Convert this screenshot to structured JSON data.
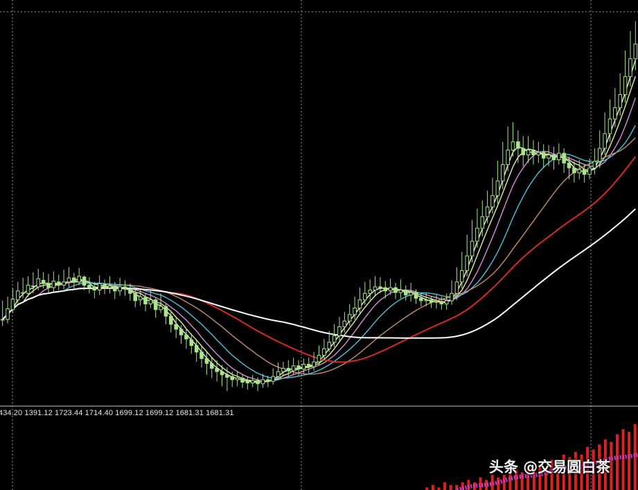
{
  "chart_data": {
    "type": "candlestick",
    "title": "",
    "main_panel": {
      "bull_color": "#a8e58b",
      "bear_color": "#a8e58b",
      "background": "#000000",
      "grid": "vertical-dotted",
      "candles": [
        [
          1680,
          1680,
          1703,
          1672
        ],
        [
          1680,
          1693,
          1708,
          1675
        ],
        [
          1692,
          1705,
          1718,
          1688
        ],
        [
          1704,
          1715,
          1726,
          1700
        ],
        [
          1712,
          1713,
          1731,
          1706
        ],
        [
          1712,
          1722,
          1733,
          1708
        ],
        [
          1721,
          1720,
          1738,
          1712
        ],
        [
          1720,
          1730,
          1742,
          1716
        ],
        [
          1728,
          1724,
          1738,
          1718
        ],
        [
          1724,
          1719,
          1736,
          1713
        ],
        [
          1719,
          1727,
          1739,
          1714
        ],
        [
          1726,
          1722,
          1735,
          1716
        ],
        [
          1722,
          1726,
          1741,
          1717
        ],
        [
          1726,
          1731,
          1744,
          1720
        ],
        [
          1731,
          1726,
          1737,
          1716
        ],
        [
          1726,
          1733,
          1743,
          1722
        ],
        [
          1732,
          1722,
          1734,
          1716
        ],
        [
          1722,
          1719,
          1732,
          1712
        ],
        [
          1720,
          1716,
          1726,
          1706
        ],
        [
          1716,
          1724,
          1734,
          1710
        ],
        [
          1723,
          1719,
          1729,
          1711
        ],
        [
          1719,
          1721,
          1733,
          1712
        ],
        [
          1721,
          1715,
          1726,
          1705
        ],
        [
          1715,
          1720,
          1731,
          1709
        ],
        [
          1720,
          1717,
          1728,
          1709
        ],
        [
          1717,
          1712,
          1724,
          1703
        ],
        [
          1712,
          1703,
          1717,
          1695
        ],
        [
          1704,
          1708,
          1716,
          1697
        ],
        [
          1707,
          1699,
          1712,
          1690
        ],
        [
          1699,
          1704,
          1717,
          1694
        ],
        [
          1704,
          1692,
          1706,
          1682
        ],
        [
          1692,
          1696,
          1712,
          1688
        ],
        [
          1696,
          1684,
          1699,
          1674
        ],
        [
          1684,
          1674,
          1690,
          1664
        ],
        [
          1674,
          1668,
          1682,
          1657
        ],
        [
          1668,
          1661,
          1673,
          1650
        ],
        [
          1661,
          1656,
          1669,
          1644
        ],
        [
          1655,
          1648,
          1663,
          1638
        ],
        [
          1648,
          1640,
          1654,
          1628
        ],
        [
          1640,
          1632,
          1647,
          1621
        ],
        [
          1632,
          1626,
          1640,
          1612
        ],
        [
          1626,
          1620,
          1634,
          1608
        ],
        [
          1620,
          1616,
          1630,
          1604
        ],
        [
          1616,
          1612,
          1624,
          1598
        ],
        [
          1612,
          1609,
          1621,
          1592
        ],
        [
          1610,
          1606,
          1616,
          1597
        ],
        [
          1606,
          1608,
          1616,
          1598
        ],
        [
          1608,
          1603,
          1612,
          1596
        ],
        [
          1604,
          1602,
          1610,
          1594
        ],
        [
          1602,
          1605,
          1612,
          1597
        ],
        [
          1605,
          1601,
          1609,
          1592
        ],
        [
          1601,
          1606,
          1613,
          1596
        ],
        [
          1606,
          1604,
          1611,
          1597
        ],
        [
          1604,
          1610,
          1620,
          1600
        ],
        [
          1610,
          1616,
          1627,
          1606
        ],
        [
          1616,
          1620,
          1628,
          1610
        ],
        [
          1620,
          1617,
          1630,
          1609
        ],
        [
          1617,
          1623,
          1633,
          1612
        ],
        [
          1623,
          1619,
          1630,
          1611
        ],
        [
          1619,
          1625,
          1632,
          1614
        ],
        [
          1625,
          1622,
          1633,
          1613
        ],
        [
          1622,
          1628,
          1640,
          1617
        ],
        [
          1628,
          1636,
          1648,
          1624
        ],
        [
          1636,
          1644,
          1656,
          1630
        ],
        [
          1644,
          1652,
          1666,
          1640
        ],
        [
          1652,
          1660,
          1674,
          1646
        ],
        [
          1660,
          1671,
          1683,
          1654
        ],
        [
          1671,
          1678,
          1689,
          1664
        ],
        [
          1678,
          1686,
          1699,
          1672
        ],
        [
          1686,
          1694,
          1708,
          1680
        ],
        [
          1694,
          1704,
          1719,
          1688
        ],
        [
          1704,
          1712,
          1726,
          1698
        ],
        [
          1712,
          1716,
          1729,
          1704
        ],
        [
          1716,
          1720,
          1733,
          1708
        ],
        [
          1720,
          1719,
          1732,
          1712
        ],
        [
          1719,
          1715,
          1727,
          1706
        ],
        [
          1715,
          1719,
          1730,
          1710
        ],
        [
          1719,
          1713,
          1725,
          1705
        ],
        [
          1713,
          1716,
          1729,
          1706
        ],
        [
          1716,
          1710,
          1722,
          1703
        ],
        [
          1710,
          1713,
          1725,
          1702
        ],
        [
          1713,
          1706,
          1717,
          1699
        ],
        [
          1706,
          1703,
          1712,
          1696
        ],
        [
          1703,
          1704,
          1712,
          1696
        ],
        [
          1704,
          1701,
          1709,
          1694
        ],
        [
          1701,
          1702,
          1710,
          1693
        ],
        [
          1702,
          1699,
          1708,
          1692
        ],
        [
          1699,
          1703,
          1712,
          1692
        ],
        [
          1703,
          1712,
          1728,
          1698
        ],
        [
          1712,
          1726,
          1744,
          1704
        ],
        [
          1726,
          1740,
          1763,
          1718
        ],
        [
          1740,
          1758,
          1784,
          1733
        ],
        [
          1758,
          1776,
          1802,
          1750
        ],
        [
          1776,
          1792,
          1816,
          1768
        ],
        [
          1792,
          1806,
          1826,
          1782
        ],
        [
          1806,
          1818,
          1838,
          1798
        ],
        [
          1818,
          1832,
          1854,
          1810
        ],
        [
          1832,
          1850,
          1875,
          1822
        ],
        [
          1850,
          1870,
          1898,
          1840
        ],
        [
          1870,
          1888,
          1917,
          1862
        ],
        [
          1888,
          1898,
          1922,
          1880
        ],
        [
          1898,
          1890,
          1912,
          1872
        ],
        [
          1890,
          1882,
          1905,
          1868
        ],
        [
          1882,
          1888,
          1905,
          1872
        ],
        [
          1888,
          1882,
          1900,
          1870
        ],
        [
          1882,
          1885,
          1898,
          1872
        ],
        [
          1885,
          1878,
          1895,
          1866
        ],
        [
          1878,
          1882,
          1894,
          1868
        ],
        [
          1882,
          1876,
          1892,
          1864
        ],
        [
          1876,
          1884,
          1896,
          1870
        ],
        [
          1884,
          1872,
          1890,
          1860
        ],
        [
          1872,
          1866,
          1880,
          1852
        ],
        [
          1866,
          1860,
          1874,
          1848
        ],
        [
          1860,
          1864,
          1876,
          1852
        ],
        [
          1864,
          1858,
          1870,
          1848
        ],
        [
          1858,
          1866,
          1878,
          1852
        ],
        [
          1866,
          1874,
          1890,
          1858
        ],
        [
          1874,
          1890,
          1912,
          1866
        ],
        [
          1890,
          1908,
          1934,
          1882
        ],
        [
          1908,
          1926,
          1950,
          1898
        ],
        [
          1926,
          1940,
          1964,
          1916
        ],
        [
          1940,
          1956,
          1982,
          1930
        ],
        [
          1956,
          1978,
          2010,
          1946
        ],
        [
          1978,
          2000,
          2034,
          1966
        ],
        [
          2000,
          2018,
          2046,
          1986
        ]
      ],
      "moving_averages": [
        {
          "period_label": "",
          "color": "#f4f1e4"
        },
        {
          "period_label": "",
          "color": "#e8f09a"
        },
        {
          "period_label": "",
          "color": "#d48fd8"
        },
        {
          "period_label": "",
          "color": "#4fc3d6"
        },
        {
          "period_label": "",
          "color": "#c4906d"
        },
        {
          "period_label": "",
          "color": "#d42b2b"
        },
        {
          "period_label": "",
          "color": "#ffffff"
        }
      ]
    },
    "value_readout": "434.20 1391.12 1723.44 1714.40 1699.12 1699.12 1681.31 1681.31",
    "sub_panel": {
      "type": "bar",
      "bar_color": "#e02020",
      "wave_color": "#c040c8",
      "values": [
        1,
        2,
        1,
        3,
        2,
        2,
        3,
        4,
        3,
        5,
        4,
        6,
        5,
        6,
        7,
        8,
        7,
        9,
        8,
        10,
        9,
        12,
        11,
        14,
        13,
        15,
        14,
        17,
        16,
        18,
        20,
        19,
        22,
        24,
        23,
        26
      ]
    }
  },
  "watermark": {
    "text": "头条 @交易圆白茶"
  }
}
